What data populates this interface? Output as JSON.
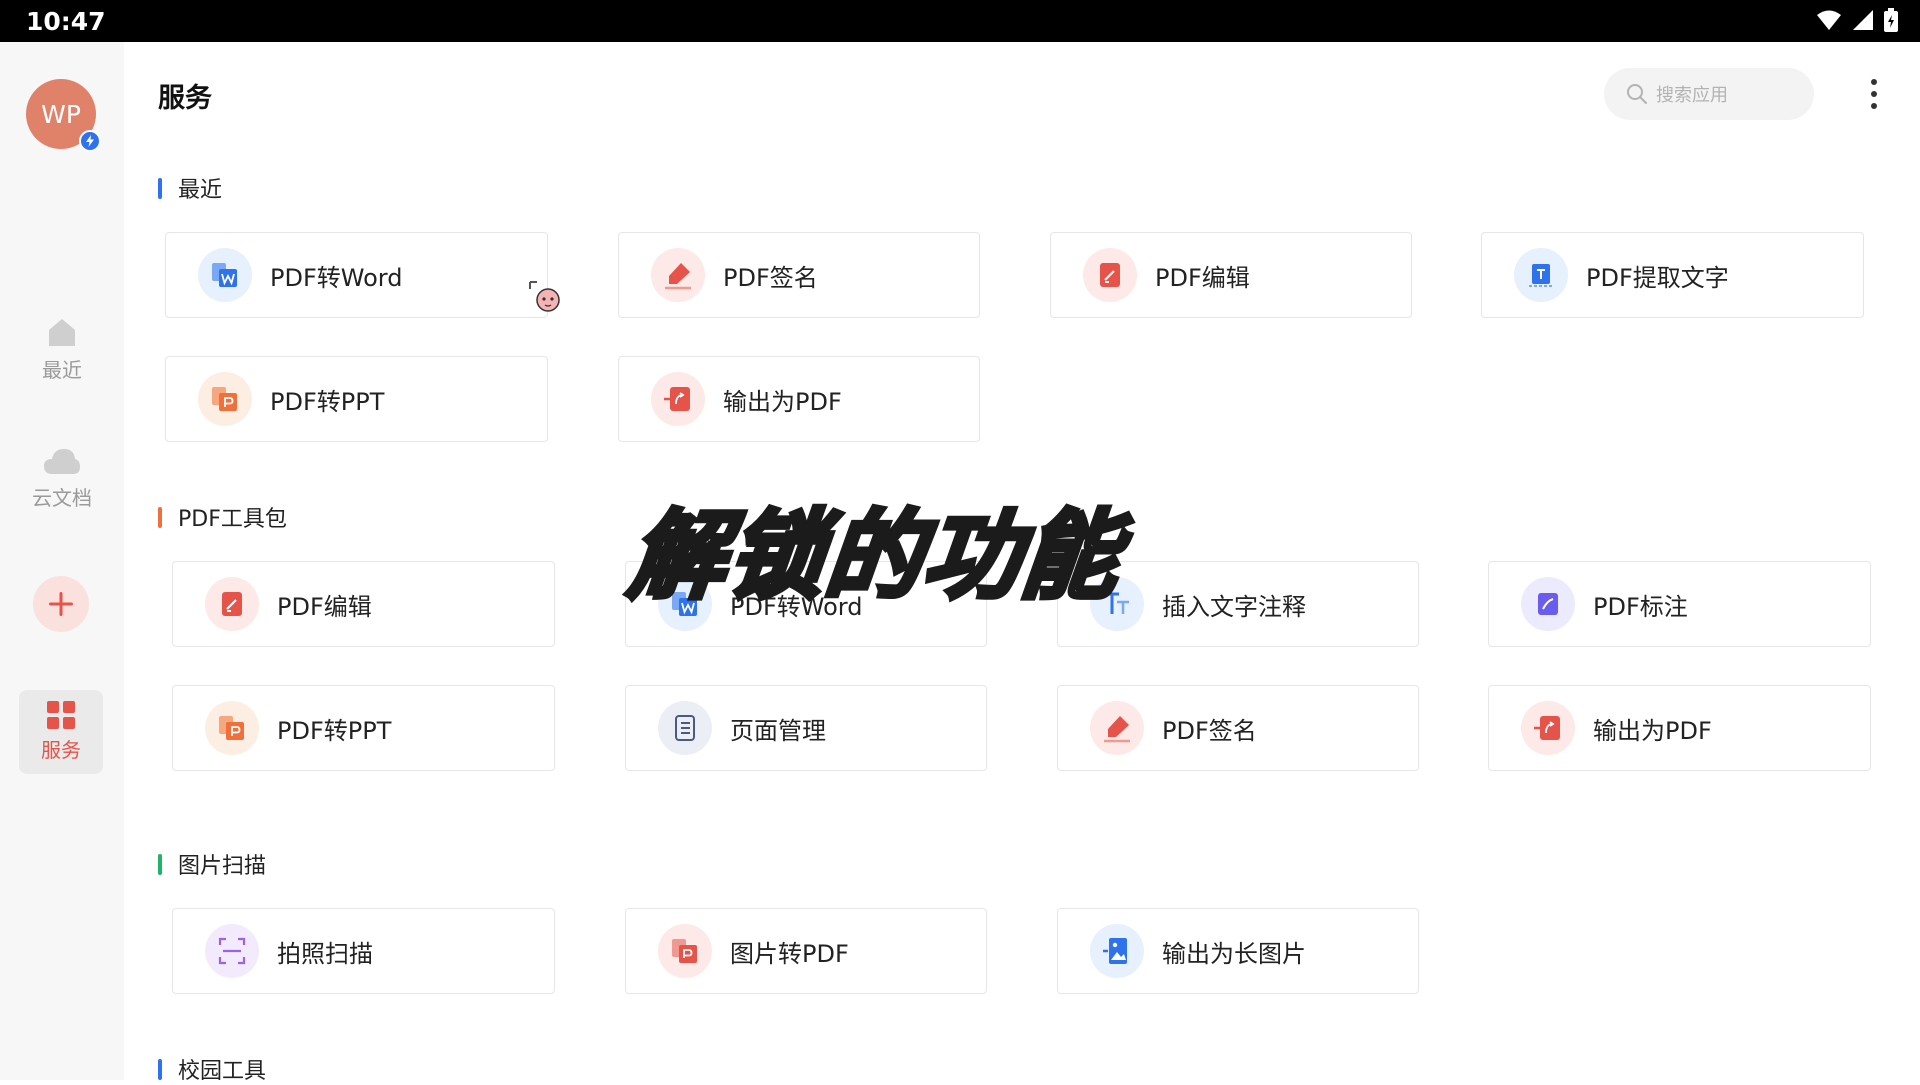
{
  "status_bar": {
    "time": "10:47"
  },
  "sidebar": {
    "avatar_text": "WP",
    "nav": [
      {
        "label": "最近",
        "icon": "home-icon"
      },
      {
        "label": "云文档",
        "icon": "cloud-icon"
      },
      {
        "label": "服务",
        "icon": "grid-icon",
        "active": true
      }
    ],
    "accent_color": "#e5534b"
  },
  "header": {
    "title": "服务",
    "search_placeholder": "搜索应用"
  },
  "sections": {
    "recent": {
      "title": "最近",
      "bar_color": "#2f72ee",
      "items": [
        "PDF转Word",
        "PDF签名",
        "PDF编辑",
        "PDF提取文字",
        "PDF转PPT",
        "输出为PDF"
      ]
    },
    "pdf_tools": {
      "title": "PDF工具包",
      "bar_color": "#f06f3b",
      "items": [
        "PDF编辑",
        "PDF转Word",
        "插入文字注释",
        "PDF标注",
        "PDF转PPT",
        "页面管理",
        "PDF签名",
        "输出为PDF"
      ]
    },
    "scan": {
      "title": "图片扫描",
      "bar_color": "#1fb36b",
      "items": [
        "拍照扫描",
        "图片转PDF",
        "输出为长图片"
      ]
    },
    "campus": {
      "title": "校园工具",
      "bar_color": "#2f72ee"
    }
  },
  "overlay": {
    "caption": "解锁的功能"
  }
}
